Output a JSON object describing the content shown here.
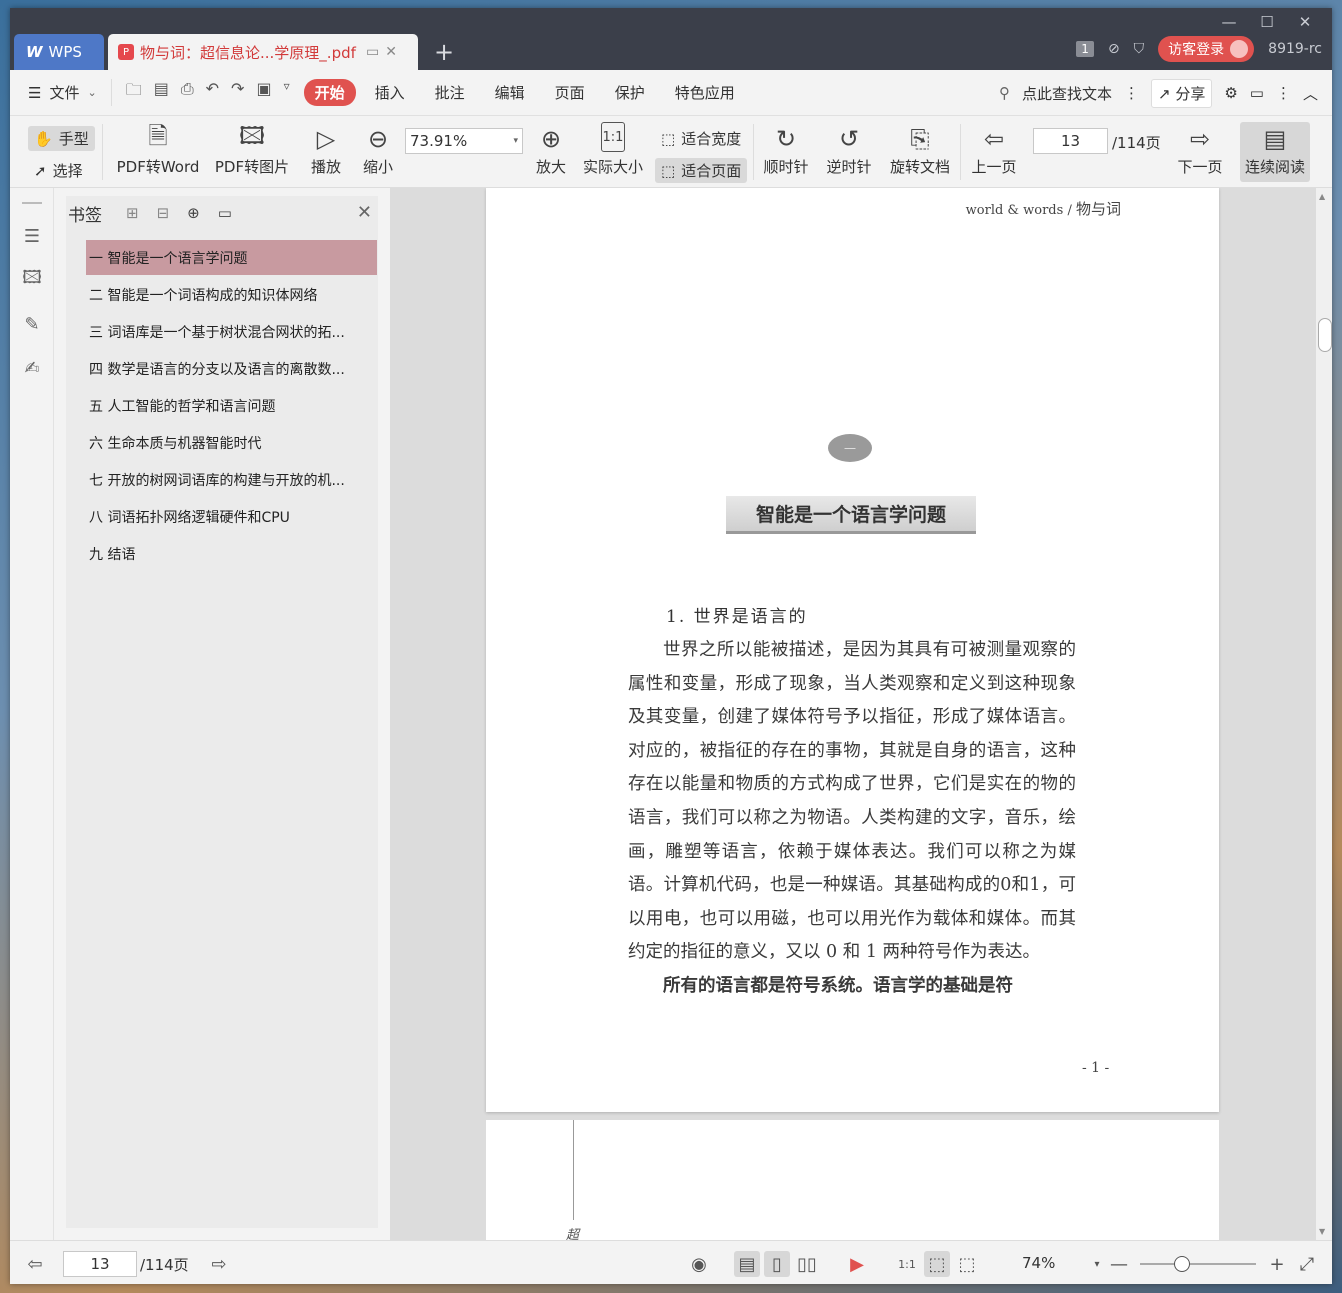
{
  "titlebar": {
    "wps_tab": "WPS",
    "doc_tab": "物与词：超信息论...学原理_.pdf",
    "count_badge": "1",
    "login": "访客登录",
    "user_id": "8919-rc"
  },
  "menubar": {
    "file": "文件",
    "tabs": [
      "开始",
      "插入",
      "批注",
      "编辑",
      "页面",
      "保护",
      "特色应用"
    ],
    "active_tab": "开始",
    "search": "点此查找文本",
    "share": "分享"
  },
  "toolbar": {
    "hand": "手型",
    "select": "选择",
    "pdf_to_word": "PDF转Word",
    "pdf_to_image": "PDF转图片",
    "play": "播放",
    "zoom_out": "缩小",
    "zoom_value": "73.91%",
    "zoom_in": "放大",
    "actual_size": "实际大小",
    "fit_width": "适合宽度",
    "fit_page": "适合页面",
    "clockwise": "顺时针",
    "counterclockwise": "逆时针",
    "rotate_doc": "旋转文档",
    "prev_page": "上一页",
    "page_current": "13",
    "page_total": "/114页",
    "next_page": "下一页",
    "continuous": "连续阅读"
  },
  "bookmarks": {
    "title": "书签",
    "items": [
      "一 智能是一个语言学问题",
      "二 智能是一个词语构成的知识体网络",
      "三 词语库是一个基于树状混合网状的拓...",
      "四 数学是语言的分支以及语言的离散数...",
      "五 人工智能的哲学和语言问题",
      "六 生命本质与机器智能时代",
      "七 开放的树网词语库的构建与开放的机...",
      "八 词语拓扑网络逻辑硬件和CPU",
      "九 结语"
    ],
    "selected_index": 0
  },
  "document": {
    "running_head_en": "world & words",
    "running_head_sep": "/",
    "running_head_zh": "物与词",
    "chapter_number": "一",
    "chapter_title": "智能是一个语言学问题",
    "section_heading": "1. 世界是语言的",
    "paragraph1": "世界之所以能被描述，是因为其具有可被测量观察的属性和变量，形成了现象，当人类观察和定义到这种现象及其变量，创建了媒体符号予以指征，形成了媒体语言。对应的，被指征的存在的事物，其就是自身的语言，这种存在以能量和物质的方式构成了世界，它们是实在的物的语言，我们可以称之为物语。人类构建的文字，音乐，绘画，雕塑等语言，依赖于媒体表达。我们可以称之为媒语。计算机代码，也是一种媒语。其基础构成的0和1，可以用电，也可以用磁，也可以用光作为载体和媒体。而其约定的指征的意义，又以 0 和 1 两种符号作为表达。",
    "paragraph2": "所有的语言都是符号系统。语言学的基础是符",
    "page_number": "- 1 -",
    "page2_char": "超"
  },
  "statusbar": {
    "page_current": "13",
    "page_total": "/114页",
    "zoom": "74%"
  },
  "colors": {
    "accent": "#e0524f",
    "titlebar": "#3b3f4a",
    "wps_blue": "#4e78c7",
    "bookmark_selected": "#c89aa0"
  }
}
